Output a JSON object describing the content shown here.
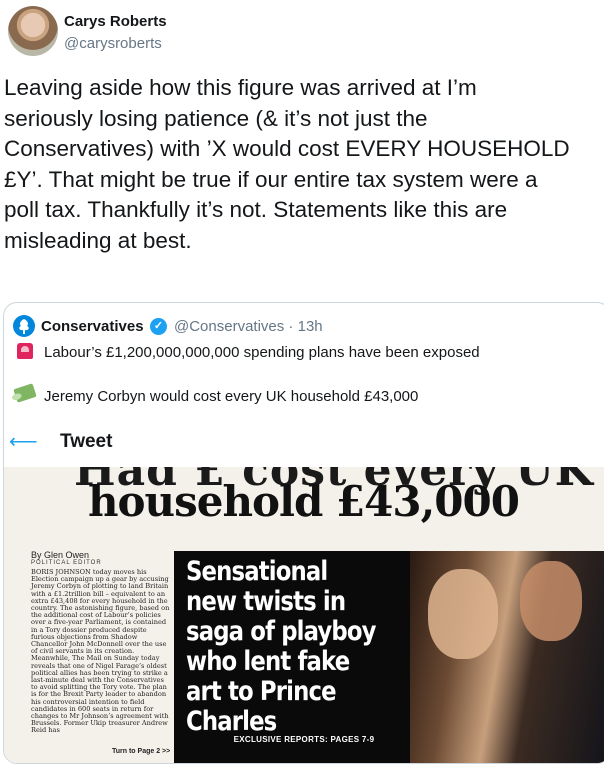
{
  "author": {
    "name": "Carys Roberts",
    "handle": "@carysroberts"
  },
  "tweet": {
    "text": "Leaving aside how this figure was arrived at I’m\nseriously losing patience (& it’s not just the\nConservatives) with ’X would cost EVERY HOUSEHOLD\n£Y’. That might be true if our entire tax system were a\npoll tax. Thankfully it’s not. Statements like this are\nmisleading at best."
  },
  "quoted": {
    "name": "Conservatives",
    "handle": "@Conservatives · 13h",
    "line1": "Labour’s £1,200,000,000,000 spending plans have been exposed",
    "line2": "Jeremy Corbyn would cost every UK household £43,000",
    "icons": {
      "line1": "police-siren-icon",
      "line2": "flying-money-icon",
      "verified": "verified-badge-icon",
      "logo": "conservatives-tree-logo"
    }
  },
  "inner_screenshot": {
    "back_icon": "back-arrow-icon",
    "title": "Tweet"
  },
  "newspaper": {
    "cut_headline": "Had £ cost every UK",
    "headline": "household £43,000",
    "byline": "By Glen Owen",
    "byline_role": "POLITICAL EDITOR",
    "article": "BORIS JOHNSON today moves his Election campaign up a gear by accusing Jeremy Corbyn of plotting to land Britain with a £1.2trillion bill – equivalent to an extra £43,408 for every household in the country. The astonishing figure, based on the additional cost of Labour’s policies over a five-year Parliament, is contained in a Tory dossier produced despite furious objections from Shadow Chancellor John McDonnell over the use of civil servants in its creation. Meanwhile, The Mail on Sunday today reveals that one of Nigel Farage’s oldest political allies has been trying to strike a last-minute deal with the Conservatives to avoid splitting the Tory vote. The plan is for the Brexit Party leader to abandon his controversial intention to field candidates in 600 seats in return for changes to Mr Johnson’s agreement with Brussels. Former Ukip treasurer Andrew Reid has",
    "turn_to": "Turn to Page 2 >>",
    "promo": "Sensational new twists in saga of playboy who lent fake art to Prince Charles",
    "exclusive": "EXCLUSIVE REPORTS: PAGES 7-9"
  },
  "colors": {
    "accent": "#1da1f2",
    "conservative_blue": "#0087dc",
    "text": "#14171a",
    "muted": "#657786"
  }
}
